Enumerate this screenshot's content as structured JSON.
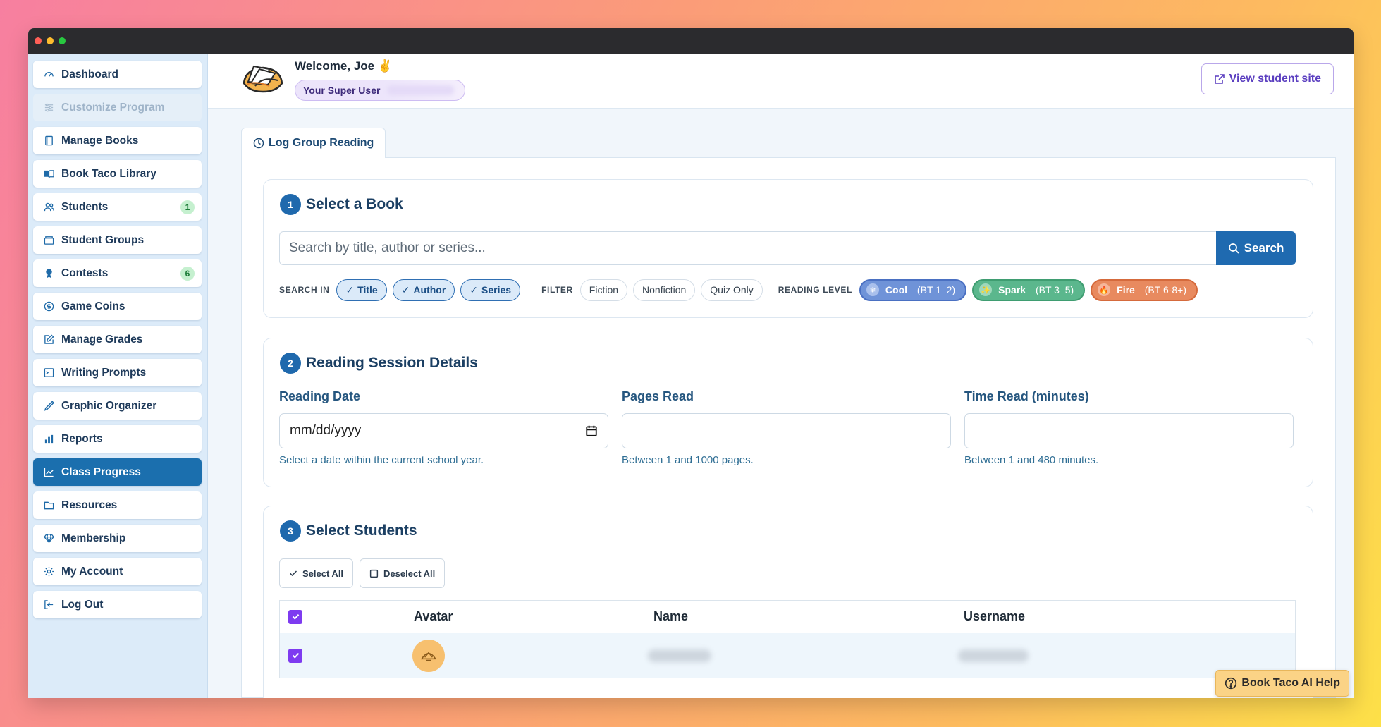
{
  "sidebar": {
    "items": [
      {
        "label": "Dashboard",
        "icon": "gauge-icon"
      },
      {
        "label": "Customize Program",
        "icon": "sliders-icon"
      },
      {
        "label": "Manage Books",
        "icon": "book-icon"
      },
      {
        "label": "Book Taco Library",
        "icon": "open-book-icon"
      },
      {
        "label": "Students",
        "icon": "users-icon",
        "badge": "1"
      },
      {
        "label": "Student Groups",
        "icon": "archive-icon"
      },
      {
        "label": "Contests",
        "icon": "award-icon",
        "badge": "6"
      },
      {
        "label": "Game Coins",
        "icon": "coin-icon"
      },
      {
        "label": "Manage Grades",
        "icon": "edit-icon"
      },
      {
        "label": "Writing Prompts",
        "icon": "terminal-icon"
      },
      {
        "label": "Graphic Organizer",
        "icon": "pen-icon"
      },
      {
        "label": "Reports",
        "icon": "bar-chart-icon"
      },
      {
        "label": "Class Progress",
        "icon": "trend-icon"
      },
      {
        "label": "Resources",
        "icon": "folder-icon"
      },
      {
        "label": "Membership",
        "icon": "gem-icon"
      },
      {
        "label": "My Account",
        "icon": "gear-icon"
      },
      {
        "label": "Log Out",
        "icon": "logout-icon"
      }
    ],
    "active_index": 12,
    "disabled_index": 1
  },
  "header": {
    "welcome": "Welcome, Joe ✌️",
    "role": "Your Super User",
    "view_site": "View student site"
  },
  "tab": {
    "label": "Log Group Reading"
  },
  "step1": {
    "num": "1",
    "title": "Select a Book",
    "search_placeholder": "Search by title, author or series...",
    "search_button": "Search",
    "search_in_label": "SEARCH IN",
    "search_in": [
      "Title",
      "Author",
      "Series"
    ],
    "filter_label": "FILTER",
    "filters": [
      "Fiction",
      "Nonfiction",
      "Quiz Only"
    ],
    "level_label": "READING LEVEL",
    "levels": [
      {
        "name": "Cool",
        "range": "(BT 1–2)",
        "icon": "snowflake-icon"
      },
      {
        "name": "Spark",
        "range": "(BT 3–5)",
        "icon": "sparkle-icon"
      },
      {
        "name": "Fire",
        "range": "(BT 6-8+)",
        "icon": "flame-icon"
      }
    ]
  },
  "step2": {
    "num": "2",
    "title": "Reading Session Details",
    "fields": [
      {
        "label": "Reading Date",
        "value": "mm/dd/yyyy",
        "help": "Select a date within the current school year."
      },
      {
        "label": "Pages Read",
        "value": "",
        "help": "Between 1 and 1000 pages."
      },
      {
        "label": "Time Read (minutes)",
        "value": "",
        "help": "Between 1 and 480 minutes."
      }
    ]
  },
  "step3": {
    "num": "3",
    "title": "Select Students",
    "select_all": "Select All",
    "deselect_all": "Deselect All",
    "columns": [
      "Avatar",
      "Name",
      "Username"
    ]
  },
  "help": {
    "label": "Book Taco AI Help"
  },
  "colors": {
    "primary": "#1f6ab0",
    "accent_purple": "#7e3bf0",
    "sidebar_bg": "#dcebf9"
  }
}
